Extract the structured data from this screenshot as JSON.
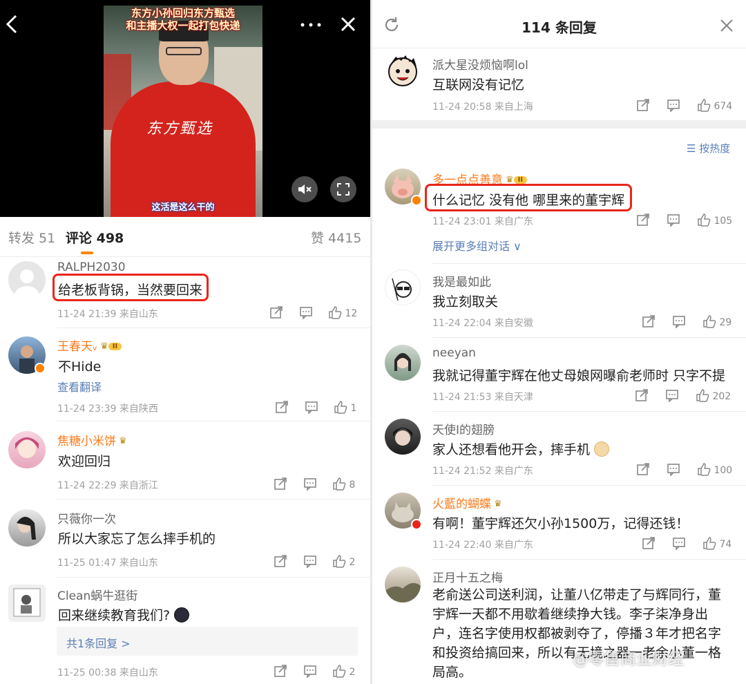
{
  "left": {
    "video": {
      "banner_text": "东方小孙回归东方甄选\n和主播大权一起打包快递",
      "logo_text": "东方甄选",
      "subtitle": "这活是这么干的",
      "back_icon": "chevron-left-icon",
      "more_icon": "more-dots-icon",
      "close_icon": "close-icon",
      "mute_icon": "mute-icon",
      "fullscreen_icon": "fullscreen-icon"
    },
    "tabs": {
      "repost": "转发 51",
      "comments": "评论 498",
      "likes": "赞 4415"
    },
    "comments": [
      {
        "user": "RALPH2030",
        "text": "给老板背锅，当然要回来",
        "meta": "11-24 21:39  来自山东",
        "likes": "12"
      },
      {
        "user": "王春天ᵥ",
        "text": "不Hide",
        "translate": "查看翻译",
        "meta": "11-24 23:39  来自陕西",
        "likes": "1"
      },
      {
        "user": "焦糖小米饼",
        "text": "欢迎回归",
        "meta": "11-24 22:29  来自浙江",
        "likes": "8"
      },
      {
        "user": "只薇你一次",
        "text": "所以大家忘了怎么摔手机的",
        "meta": "11-25 01:47  来自山东",
        "likes": "2"
      },
      {
        "user": "Clean蜗牛逛街",
        "text": "回来继续教育我们?",
        "replies": "共1条回复 >",
        "meta": "11-25 00:38  来自山东",
        "likes": "2"
      }
    ]
  },
  "right": {
    "title": "114 条回复",
    "refresh_icon": "refresh-icon",
    "close_icon": "close-icon",
    "sort": "按热度",
    "top_comment": {
      "user": "派大星没烦恼啊lol",
      "text": "互联网没有记忆",
      "meta": "11-24 20:58  来自上海",
      "likes": "674"
    },
    "comments": [
      {
        "user": "多一点点善意",
        "text": "什么记忆 没有他 哪里来的董宇辉",
        "meta": "11-24 23:01  来自广东",
        "likes": "105",
        "expand": "展开更多组对话 ∨"
      },
      {
        "user": "我是最如此",
        "text": "我立刻取关",
        "meta": "11-24 22:04  来自安徽",
        "likes": "29"
      },
      {
        "user": "neeyan",
        "text": "我就记得董宇辉在他丈母娘网曝俞老师时 只字不提",
        "meta": "11-24 21:53  来自天津",
        "likes": "202"
      },
      {
        "user": "天使I的翅膀",
        "text": "家人还想看他开会，摔手机",
        "meta": "11-24 21:52  来自广东",
        "likes": "100"
      },
      {
        "user": "火藍的蝴蝶",
        "text": "有啊！董宇辉还欠小孙1500万，记得还钱！",
        "meta": "11-24 22:40  来自广东",
        "likes": "74"
      },
      {
        "user": "正月十五之梅",
        "text": "老俞送公司送利润，让董八亿带走了与辉同行，董宇辉一天都不用歇着继续挣大钱。李子柒净身出户，连名字使用权都被剥夺了，停播３年才把名字和投资给搞回来，所以有无境之器一老余小董一格局高。"
      }
    ],
    "watermark": "@零售商业财经"
  },
  "colors": {
    "accent": "#ff8200",
    "highlight": "#e8251a",
    "link": "#5a7fb5"
  }
}
